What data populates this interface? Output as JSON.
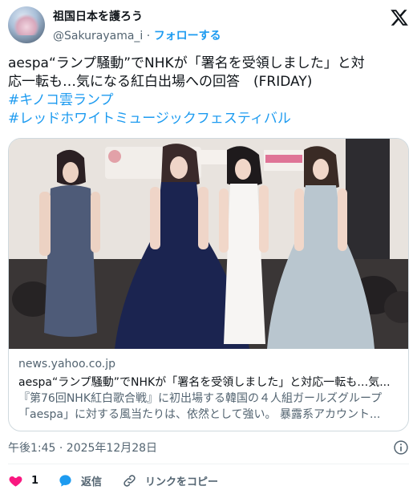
{
  "author": {
    "display_name": "祖国日本を護ろう",
    "handle": "@Sakurayama_i",
    "separator": " · ",
    "follow_label": "フォローする"
  },
  "tweet": {
    "text_line1": "aespa“ランプ騒動”でNHKが「署名を受領しました」と対",
    "text_line2": "応一転も…気になる紅白出場への回答　(FRIDAY)",
    "hashtags": [
      "#キノコ雲ランプ",
      "#レッドホワイトミュージックフェスティバル"
    ],
    "timestamp": "午後1:45 · 2025年12月28日"
  },
  "card": {
    "domain": "news.yahoo.co.jp",
    "title": "aespa“ランプ騒動”でNHKが「署名を受領しました」と対応一転も…気...",
    "description_line1": "『第76回NHK紅白歌合戦』に初出場する韓国の４人組ガールズグループ",
    "description_line2": "「aespa」に対する風当たりは、依然として強い。 暴露系アカウント..."
  },
  "actions": {
    "like_count": "1",
    "reply_label": "返信",
    "copy_link_label": "リンクをコピー"
  },
  "colors": {
    "accent": "#1d9bf0",
    "like": "#f91880",
    "text": "#0f1419",
    "secondary": "#536471"
  },
  "icons": [
    "x-logo-icon",
    "info-icon",
    "heart-icon",
    "reply-icon",
    "link-icon"
  ]
}
